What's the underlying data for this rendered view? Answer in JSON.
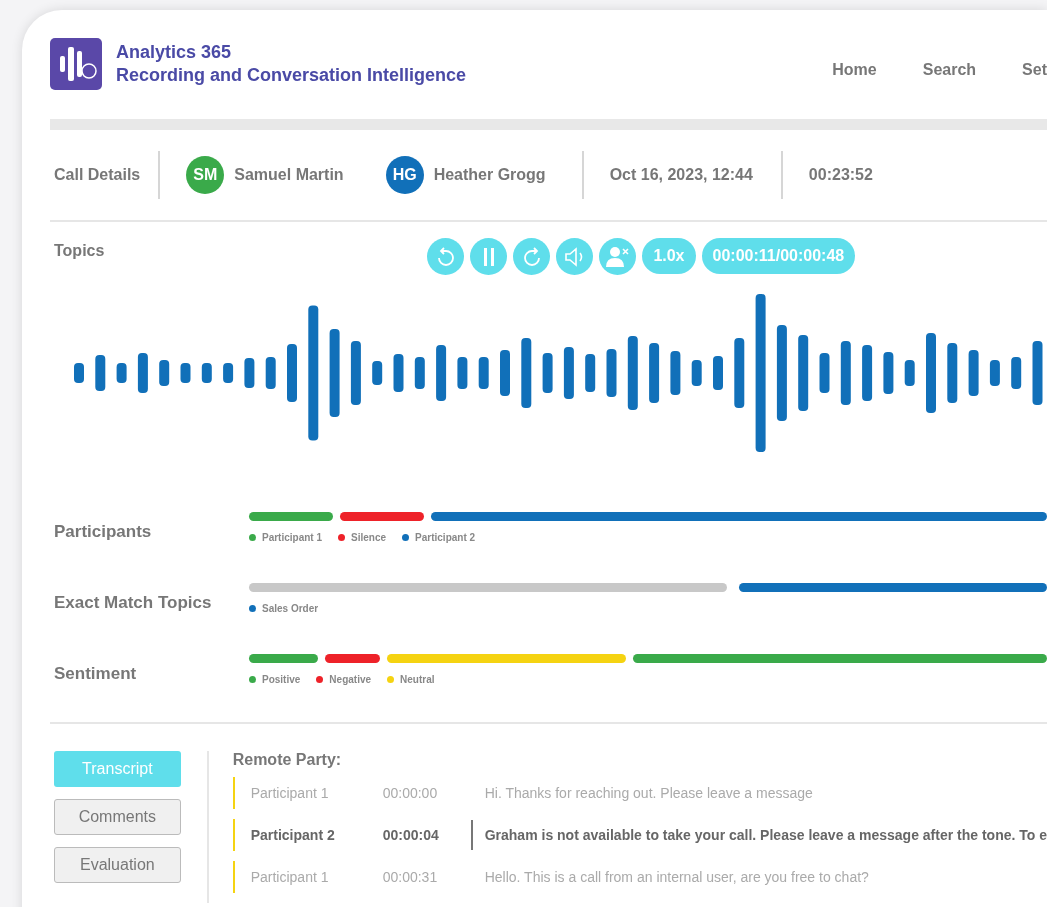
{
  "header": {
    "title": "Analytics 365",
    "subtitle": "Recording and Conversation Intelligence",
    "nav": [
      "Home",
      "Search",
      "Set"
    ]
  },
  "call_details": {
    "label": "Call Details",
    "participants": [
      {
        "initials": "SM",
        "name": "Samuel Martin",
        "color": "#3aaa4a"
      },
      {
        "initials": "HG",
        "name": "Heather Grogg",
        "color": "#1170b9"
      }
    ],
    "datetime": "Oct 16, 2023, 12:44",
    "duration": "00:23:52"
  },
  "player": {
    "label": "Topics",
    "controls": [
      {
        "kind": "rewind"
      },
      {
        "kind": "pause"
      },
      {
        "kind": "forward"
      },
      {
        "kind": "volume"
      },
      {
        "kind": "mute-speaker"
      }
    ],
    "speed": "1.0x",
    "time": "00:00:11/00:00:48"
  },
  "tracks": [
    {
      "label": "Participants",
      "segments": [
        {
          "color": "#3aaa4a"
        },
        {
          "color": "#ee2229"
        },
        {
          "color": "#1170b9"
        }
      ],
      "legend": [
        {
          "label": "Participant 1",
          "color": "#3aaa4a"
        },
        {
          "label": "Silence",
          "color": "#ee2229"
        },
        {
          "label": "Participant 2",
          "color": "#1170b9"
        }
      ]
    },
    {
      "label": "Exact Match Topics",
      "segments": [
        {
          "color": "#c8c8c8"
        },
        {
          "color": "#1170b9"
        }
      ],
      "legend": [
        {
          "label": "Sales Order",
          "color": "#1170b9"
        }
      ]
    },
    {
      "label": "Sentiment",
      "segments": [
        {
          "color": "#3aaa4a"
        },
        {
          "color": "#ee2229"
        },
        {
          "color": "#f5d311"
        },
        {
          "color": "#3aaa4a"
        }
      ],
      "legend": [
        {
          "label": "Positive",
          "color": "#3aaa4a"
        },
        {
          "label": "Negative",
          "color": "#ee2229"
        },
        {
          "label": "Neutral",
          "color": "#f5d311"
        }
      ]
    }
  ],
  "tabs": [
    {
      "label": "Transcript",
      "selected": true
    },
    {
      "label": "Comments",
      "selected": false
    },
    {
      "label": "Evaluation",
      "selected": false
    }
  ],
  "transcript": {
    "heading": "Remote Party:",
    "rows": [
      {
        "speaker": "Participant 1",
        "time": "00:00:00",
        "text": "Hi. Thanks for reaching out. Please leave a message",
        "selected": false
      },
      {
        "speaker": "Participant 2",
        "time": "00:00:04",
        "text": "Graham is not available to take your call. Please leave a message after the tone. To e",
        "selected": true
      },
      {
        "speaker": "Participant 1",
        "time": "00:00:31",
        "text": "Hello. This is a call from an internal user, are you free to chat?",
        "selected": false
      }
    ]
  }
}
